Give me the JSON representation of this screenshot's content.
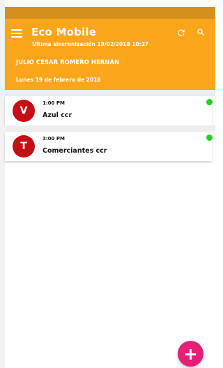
{
  "header": {
    "title": "Eco Mobile",
    "sync_text": "Última sincronización 19/02/2018 10:27",
    "user_name": "JULIO CÉSAR ROMERO HERNAN",
    "date": "Lunes 19 de febrero de 2018",
    "menu_icon": "hamburger-menu-icon",
    "refresh_icon": "refresh-icon",
    "search_icon": "search-icon"
  },
  "appointments": [
    {
      "initial": "V",
      "time": "1:00 PM",
      "title": "Azul ccr",
      "status": "online"
    },
    {
      "initial": "T",
      "time": "3:00 PM",
      "title": "Comerciantes ccr",
      "status": "online"
    }
  ],
  "fab": {
    "label": "+"
  },
  "colors": {
    "status_bar": "#d4901c",
    "app_bar": "#fba51b",
    "avatar": "#c30f16",
    "status_dot": "#1fd21f",
    "fab": "#e51f78"
  }
}
